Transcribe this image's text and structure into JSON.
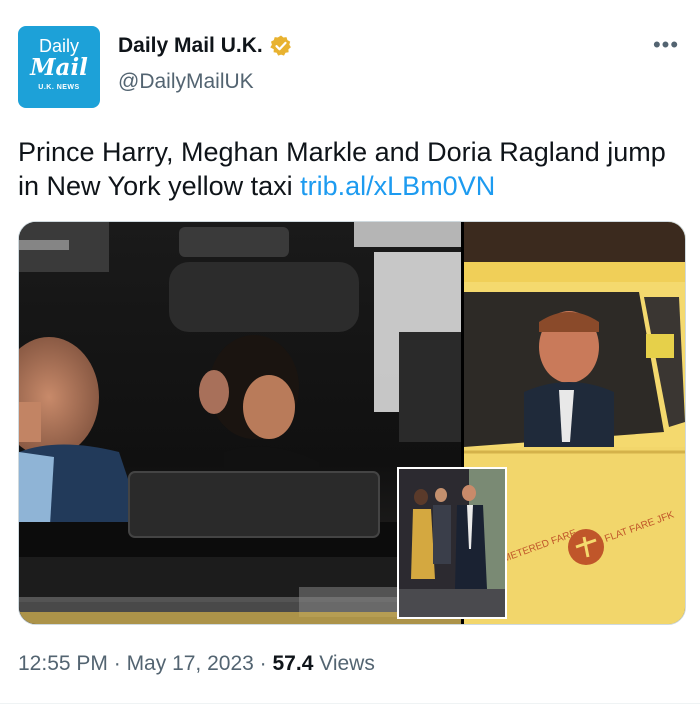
{
  "author": {
    "display_name": "Daily Mail U.K.",
    "handle": "@DailyMailUK",
    "verified": true,
    "verified_color": "#e8b230",
    "avatar": {
      "line1": "Daily",
      "line2": "Mail",
      "line3": "U.K. NEWS",
      "background": "#1da1d8"
    }
  },
  "more_icon": "more-horizontal-icon",
  "tweet": {
    "text": "Prince Harry, Meghan Markle and Doria Ragland jump in New York yellow taxi ",
    "link": "trib.al/xLBm0VN",
    "link_color": "#1d9bf0"
  },
  "media": {
    "taxi_door_text_1": "METERED FARE",
    "taxi_door_text_2": "FLAT FARE JFK"
  },
  "meta": {
    "time": "12:55 PM",
    "separator": " · ",
    "date": "May 17, 2023",
    "views_count": "57.4",
    "views_label": " Views"
  }
}
